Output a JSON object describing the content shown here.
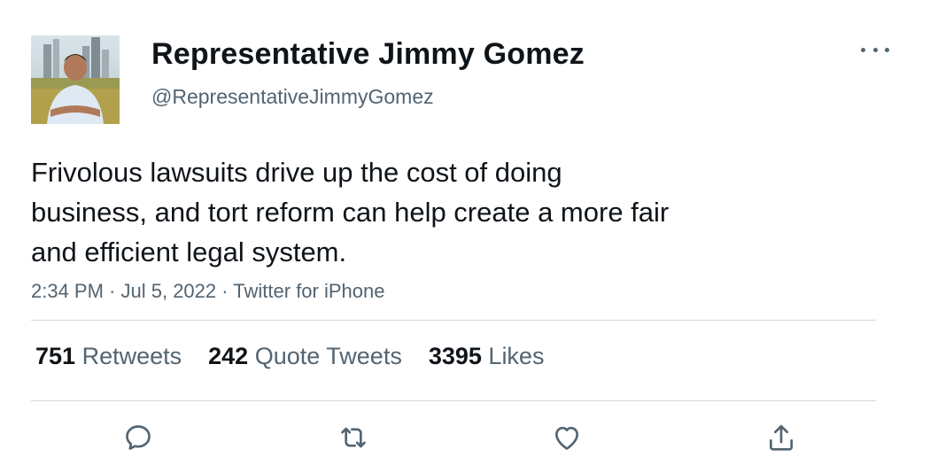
{
  "author": {
    "display_name": "Representative Jimmy Gomez",
    "handle": "@RepresentativeJimmyGomez"
  },
  "tweet": {
    "lines": [
      "Frivolous lawsuits drive up the cost of doing",
      "business, and tort reform can help create a more fair",
      "and efficient legal system."
    ],
    "time": "2:34 PM",
    "date": "Jul 5, 2022",
    "source": "Twitter for iPhone",
    "separator": " · "
  },
  "stats": {
    "retweets": {
      "count": "751",
      "label": "Retweets"
    },
    "quotes": {
      "count": "242",
      "label": "Quote Tweets"
    },
    "likes": {
      "count": "3395",
      "label": "Likes"
    }
  },
  "icons": {
    "more": "more-dots-icon",
    "reply": "reply-icon",
    "retweet": "retweet-icon",
    "like": "heart-icon",
    "share": "share-icon"
  },
  "colors": {
    "text": "#0f1419",
    "secondary": "#536471",
    "divider": "#cfd9de"
  }
}
